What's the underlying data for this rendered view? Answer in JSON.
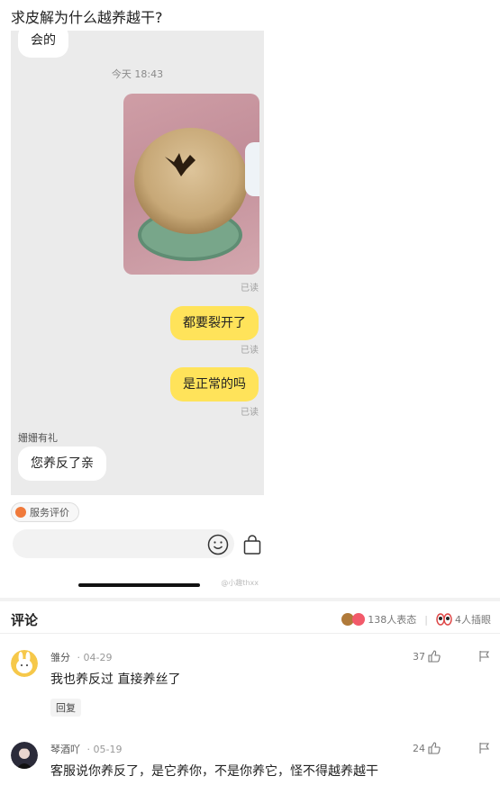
{
  "post": {
    "title": "求皮解为什么越养越干?"
  },
  "chat": {
    "top_bubble": "会的",
    "timestamp": "今天 18:43",
    "read_label": "已读",
    "messages": [
      {
        "from": "me",
        "text": "都要裂开了"
      },
      {
        "from": "me",
        "text": "是正常的吗"
      }
    ],
    "agent_name": "姗姗有礼",
    "agent_reply": "您养反了亲",
    "service_rating": "服务评价",
    "watermark": "@小趣thxx"
  },
  "comments_section": {
    "title": "评论",
    "reactions_count": "138人表态",
    "eye_roll_count": "4人插眼",
    "comments": [
      {
        "user": "雏分",
        "date": "04-29",
        "text": "我也养反过 直接养丝了",
        "likes": "37",
        "reply_label": "回复"
      },
      {
        "user": "琴酒吖",
        "date": "05-19",
        "text": "客服说你养反了，是它养你，不是你养它，怪不得越养越干",
        "likes": "24"
      }
    ]
  },
  "colors": {
    "user_bubble": "#ffe35a",
    "chat_bg": "#ebebeb"
  }
}
